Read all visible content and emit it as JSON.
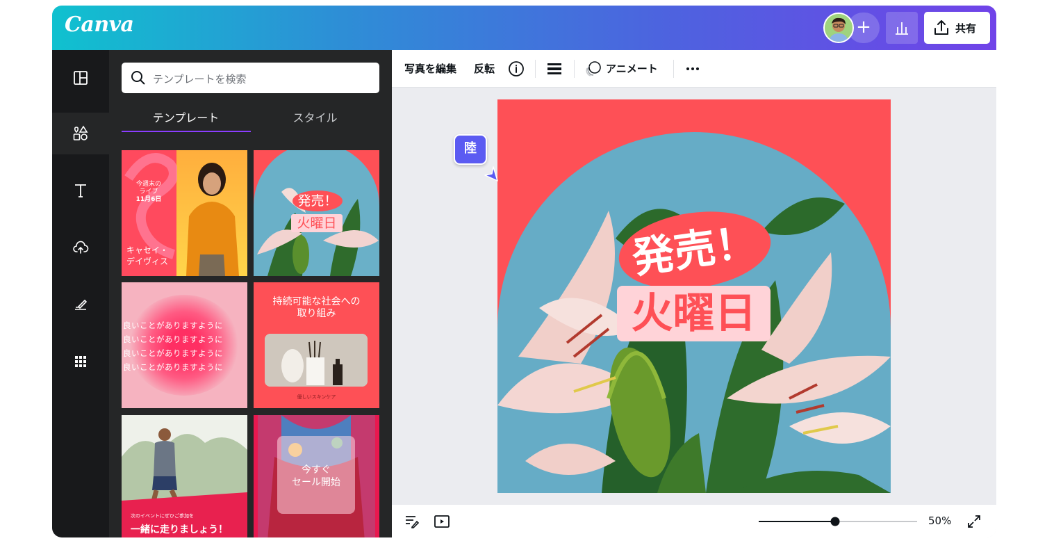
{
  "header": {
    "logo": "Canva",
    "share_label": "共有",
    "colors": {
      "gradient_start": "#10c1cf",
      "gradient_end": "#7043e8"
    }
  },
  "rail": {
    "icons": [
      "layout-icon",
      "elements-icon",
      "text-icon",
      "upload-icon",
      "draw-icon",
      "apps-icon"
    ]
  },
  "panel": {
    "search_placeholder": "テンプレートを検索",
    "tabs": [
      {
        "label": "テンプレート",
        "active": true
      },
      {
        "label": "スタイル",
        "active": false
      }
    ],
    "templates": {
      "t1": {
        "line1": "今週末の",
        "line2": "ライブ",
        "line3": "11月6日",
        "name1": "キャセイ・",
        "name2": "デイヴィス"
      },
      "t2": {
        "line1": "発売！",
        "line2": "火曜日"
      },
      "t3": {
        "lines": [
          "良いことがありますように",
          "良いことがありますように",
          "良いことがありますように",
          "良いことがありますように"
        ]
      },
      "t4": {
        "title1": "持続可能な社会への",
        "title2": "取り組み",
        "caption": "優しいスキンケア"
      },
      "t5": {
        "small": "次のイベントにぜひご参加を",
        "big": "一緒に走りましょう！"
      },
      "t6": {
        "line1": "今すぐ",
        "line2": "セール開始"
      }
    }
  },
  "toolbar": {
    "edit_photo": "写真を編集",
    "flip": "反転",
    "animate": "アニメート"
  },
  "canvas": {
    "headline": "発売！",
    "subheadline": "火曜日",
    "collaborator_label": "陸",
    "background_color": "#fe5056"
  },
  "footer": {
    "zoom": "50%",
    "zoom_fraction": 0.5
  }
}
